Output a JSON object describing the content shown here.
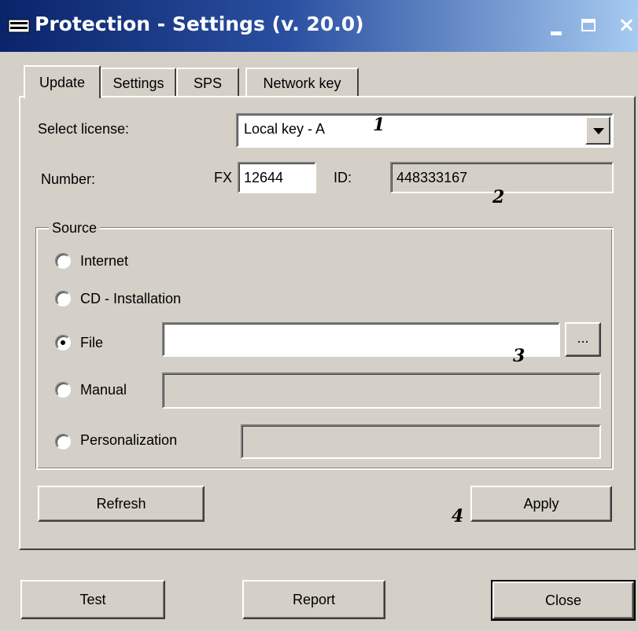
{
  "window": {
    "title": "Protection - Settings (v. 20.0)",
    "minimize_label": "_",
    "close_label": "×"
  },
  "tabs": [
    {
      "label": "Update",
      "active": true
    },
    {
      "label": "Settings",
      "active": false
    },
    {
      "label": "SPS",
      "active": false
    },
    {
      "label": "Network key",
      "active": false
    }
  ],
  "update": {
    "select_license_label": "Select license:",
    "license_value": "Local key - A",
    "number_label": "Number:",
    "fx_prefix": "FX",
    "fx_value": "12644",
    "id_label": "ID:",
    "id_value": "448333167",
    "source": {
      "title": "Source",
      "options": [
        {
          "label": "Internet",
          "selected": false
        },
        {
          "label": "CD - Installation",
          "selected": false
        },
        {
          "label": "File",
          "selected": true
        },
        {
          "label": "Manual",
          "selected": false
        },
        {
          "label": "Personalization",
          "selected": false
        }
      ],
      "file_value": "",
      "browse_label": "...",
      "manual_value": "",
      "personalization_value": ""
    },
    "refresh_label": "Refresh",
    "apply_label": "Apply"
  },
  "annotations": [
    "1",
    "2",
    "3",
    "4"
  ],
  "footer": {
    "test_label": "Test",
    "report_label": "Report",
    "close_label": "Close"
  },
  "colors": {
    "title_gradient_start": "#0a246a",
    "title_gradient_end": "#a6caf0",
    "face": "#d4d0c8"
  }
}
